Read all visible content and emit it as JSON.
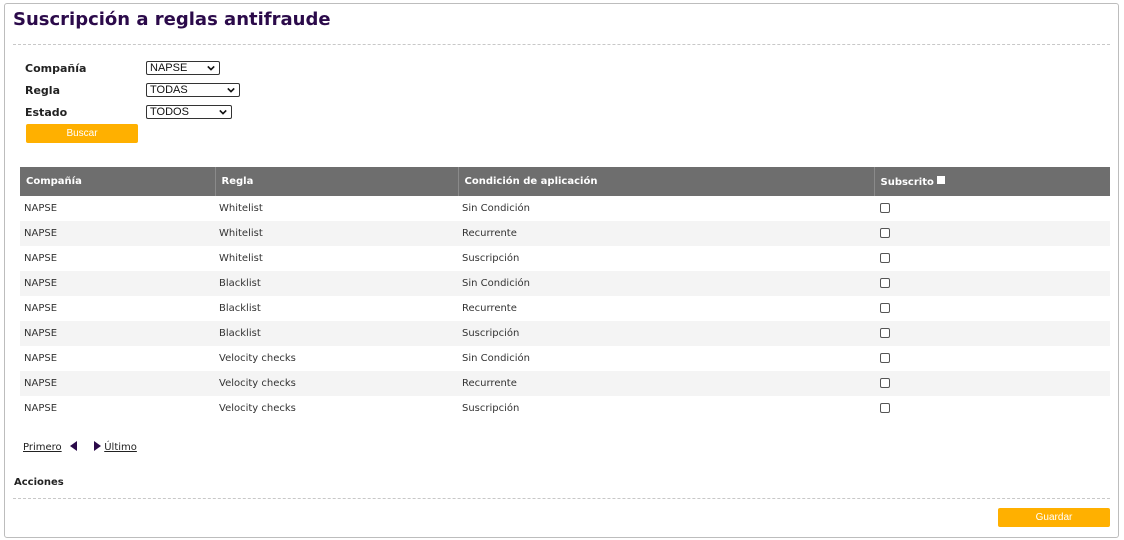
{
  "page": {
    "title": "Suscripción a reglas antifraude"
  },
  "filters": {
    "company_label": "Compañía",
    "company_value": "NAPSE",
    "rule_label": "Regla",
    "rule_value": "TODAS",
    "state_label": "Estado",
    "state_value": "TODOS",
    "search_button": "Buscar"
  },
  "table": {
    "headers": [
      "Compañía",
      "Regla",
      "Condición de aplicación",
      "Subscrito"
    ],
    "rows": [
      [
        "NAPSE",
        "Whitelist",
        "Sin Condición"
      ],
      [
        "NAPSE",
        "Whitelist",
        "Recurrente"
      ],
      [
        "NAPSE",
        "Whitelist",
        "Suscripción"
      ],
      [
        "NAPSE",
        "Blacklist",
        "Sin Condición"
      ],
      [
        "NAPSE",
        "Blacklist",
        "Recurrente"
      ],
      [
        "NAPSE",
        "Blacklist",
        "Suscripción"
      ],
      [
        "NAPSE",
        "Velocity checks",
        "Sin Condición"
      ],
      [
        "NAPSE",
        "Velocity checks",
        "Recurrente"
      ],
      [
        "NAPSE",
        "Velocity checks",
        "Suscripción"
      ]
    ]
  },
  "pager": {
    "first": "Primero",
    "last": "Último"
  },
  "actions": {
    "label": "Acciones",
    "save_button": "Guardar"
  },
  "colors": {
    "accent": "#ffb000",
    "header_bg": "#6e6e6e",
    "title": "#2b0a4a"
  }
}
